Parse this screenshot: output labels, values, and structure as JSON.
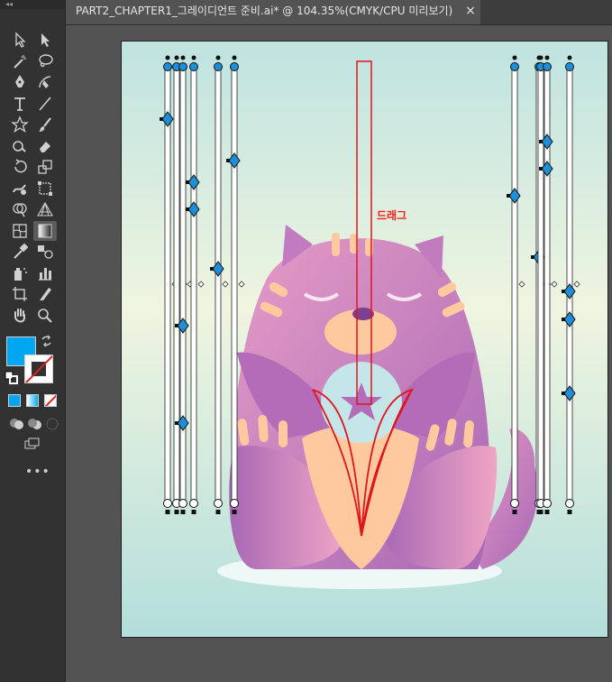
{
  "toolbar": {
    "collapse_glyph": "◂◂",
    "tools": [
      {
        "name": "selection-tool-icon"
      },
      {
        "name": "direct-selection-tool-icon"
      },
      {
        "name": "magic-wand-tool-icon"
      },
      {
        "name": "lasso-tool-icon"
      },
      {
        "name": "pen-tool-icon"
      },
      {
        "name": "curvature-tool-icon"
      },
      {
        "name": "type-tool-icon"
      },
      {
        "name": "line-segment-tool-icon"
      },
      {
        "name": "star-tool-icon"
      },
      {
        "name": "paintbrush-tool-icon"
      },
      {
        "name": "shaper-tool-icon"
      },
      {
        "name": "eraser-tool-icon"
      },
      {
        "name": "rotate-tool-icon"
      },
      {
        "name": "scale-tool-icon"
      },
      {
        "name": "warp-tool-icon"
      },
      {
        "name": "free-transform-tool-icon"
      },
      {
        "name": "shape-builder-tool-icon"
      },
      {
        "name": "perspective-grid-tool-icon"
      },
      {
        "name": "mesh-tool-icon"
      },
      {
        "name": "gradient-tool-icon",
        "active": true
      },
      {
        "name": "eyedropper-tool-icon"
      },
      {
        "name": "blend-tool-icon"
      },
      {
        "name": "symbol-sprayer-tool-icon"
      },
      {
        "name": "column-graph-tool-icon"
      },
      {
        "name": "artboard-tool-icon"
      },
      {
        "name": "slice-tool-icon"
      },
      {
        "name": "hand-tool-icon"
      },
      {
        "name": "zoom-tool-icon"
      }
    ],
    "fill_color": "#00a6f0",
    "stroke_color": "#ffffff",
    "more_label": "•••"
  },
  "tab": {
    "title": "PART2_CHAPTER1_그레이디언트 준비.ai* @ 104.35%(CMYK/CPU 미리보기)",
    "close_glyph": "×"
  },
  "canvas": {
    "annotation": "드래그",
    "annotation_color": "#ff1a1a",
    "gradient_line_color": "#e0151c",
    "colors": {
      "background_top": "#bfe3e0",
      "background_mid": "#eff5e0",
      "background_bottom": "#b3dedb",
      "cat_pink": "#e69cc6",
      "cat_purple": "#a768b5",
      "cat_peach": "#ffc9a0",
      "moon": "#a86ab0",
      "ball": "#c5e6e8",
      "handle_blue": "#1e8fd6"
    }
  }
}
